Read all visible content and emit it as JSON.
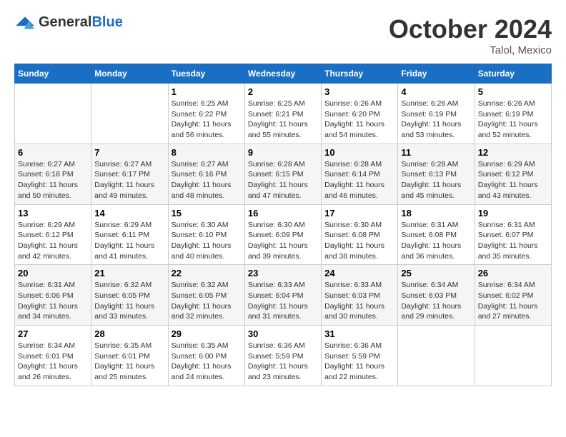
{
  "header": {
    "logo_general": "General",
    "logo_blue": "Blue",
    "month_title": "October 2024",
    "location": "Talol, Mexico"
  },
  "weekdays": [
    "Sunday",
    "Monday",
    "Tuesday",
    "Wednesday",
    "Thursday",
    "Friday",
    "Saturday"
  ],
  "weeks": [
    [
      {
        "day": "",
        "sunrise": "",
        "sunset": "",
        "daylight": ""
      },
      {
        "day": "",
        "sunrise": "",
        "sunset": "",
        "daylight": ""
      },
      {
        "day": "1",
        "sunrise": "Sunrise: 6:25 AM",
        "sunset": "Sunset: 6:22 PM",
        "daylight": "Daylight: 11 hours and 56 minutes."
      },
      {
        "day": "2",
        "sunrise": "Sunrise: 6:25 AM",
        "sunset": "Sunset: 6:21 PM",
        "daylight": "Daylight: 11 hours and 55 minutes."
      },
      {
        "day": "3",
        "sunrise": "Sunrise: 6:26 AM",
        "sunset": "Sunset: 6:20 PM",
        "daylight": "Daylight: 11 hours and 54 minutes."
      },
      {
        "day": "4",
        "sunrise": "Sunrise: 6:26 AM",
        "sunset": "Sunset: 6:19 PM",
        "daylight": "Daylight: 11 hours and 53 minutes."
      },
      {
        "day": "5",
        "sunrise": "Sunrise: 6:26 AM",
        "sunset": "Sunset: 6:19 PM",
        "daylight": "Daylight: 11 hours and 52 minutes."
      }
    ],
    [
      {
        "day": "6",
        "sunrise": "Sunrise: 6:27 AM",
        "sunset": "Sunset: 6:18 PM",
        "daylight": "Daylight: 11 hours and 50 minutes."
      },
      {
        "day": "7",
        "sunrise": "Sunrise: 6:27 AM",
        "sunset": "Sunset: 6:17 PM",
        "daylight": "Daylight: 11 hours and 49 minutes."
      },
      {
        "day": "8",
        "sunrise": "Sunrise: 6:27 AM",
        "sunset": "Sunset: 6:16 PM",
        "daylight": "Daylight: 11 hours and 48 minutes."
      },
      {
        "day": "9",
        "sunrise": "Sunrise: 6:28 AM",
        "sunset": "Sunset: 6:15 PM",
        "daylight": "Daylight: 11 hours and 47 minutes."
      },
      {
        "day": "10",
        "sunrise": "Sunrise: 6:28 AM",
        "sunset": "Sunset: 6:14 PM",
        "daylight": "Daylight: 11 hours and 46 minutes."
      },
      {
        "day": "11",
        "sunrise": "Sunrise: 6:28 AM",
        "sunset": "Sunset: 6:13 PM",
        "daylight": "Daylight: 11 hours and 45 minutes."
      },
      {
        "day": "12",
        "sunrise": "Sunrise: 6:29 AM",
        "sunset": "Sunset: 6:12 PM",
        "daylight": "Daylight: 11 hours and 43 minutes."
      }
    ],
    [
      {
        "day": "13",
        "sunrise": "Sunrise: 6:29 AM",
        "sunset": "Sunset: 6:12 PM",
        "daylight": "Daylight: 11 hours and 42 minutes."
      },
      {
        "day": "14",
        "sunrise": "Sunrise: 6:29 AM",
        "sunset": "Sunset: 6:11 PM",
        "daylight": "Daylight: 11 hours and 41 minutes."
      },
      {
        "day": "15",
        "sunrise": "Sunrise: 6:30 AM",
        "sunset": "Sunset: 6:10 PM",
        "daylight": "Daylight: 11 hours and 40 minutes."
      },
      {
        "day": "16",
        "sunrise": "Sunrise: 6:30 AM",
        "sunset": "Sunset: 6:09 PM",
        "daylight": "Daylight: 11 hours and 39 minutes."
      },
      {
        "day": "17",
        "sunrise": "Sunrise: 6:30 AM",
        "sunset": "Sunset: 6:08 PM",
        "daylight": "Daylight: 11 hours and 38 minutes."
      },
      {
        "day": "18",
        "sunrise": "Sunrise: 6:31 AM",
        "sunset": "Sunset: 6:08 PM",
        "daylight": "Daylight: 11 hours and 36 minutes."
      },
      {
        "day": "19",
        "sunrise": "Sunrise: 6:31 AM",
        "sunset": "Sunset: 6:07 PM",
        "daylight": "Daylight: 11 hours and 35 minutes."
      }
    ],
    [
      {
        "day": "20",
        "sunrise": "Sunrise: 6:31 AM",
        "sunset": "Sunset: 6:06 PM",
        "daylight": "Daylight: 11 hours and 34 minutes."
      },
      {
        "day": "21",
        "sunrise": "Sunrise: 6:32 AM",
        "sunset": "Sunset: 6:05 PM",
        "daylight": "Daylight: 11 hours and 33 minutes."
      },
      {
        "day": "22",
        "sunrise": "Sunrise: 6:32 AM",
        "sunset": "Sunset: 6:05 PM",
        "daylight": "Daylight: 11 hours and 32 minutes."
      },
      {
        "day": "23",
        "sunrise": "Sunrise: 6:33 AM",
        "sunset": "Sunset: 6:04 PM",
        "daylight": "Daylight: 11 hours and 31 minutes."
      },
      {
        "day": "24",
        "sunrise": "Sunrise: 6:33 AM",
        "sunset": "Sunset: 6:03 PM",
        "daylight": "Daylight: 11 hours and 30 minutes."
      },
      {
        "day": "25",
        "sunrise": "Sunrise: 6:34 AM",
        "sunset": "Sunset: 6:03 PM",
        "daylight": "Daylight: 11 hours and 29 minutes."
      },
      {
        "day": "26",
        "sunrise": "Sunrise: 6:34 AM",
        "sunset": "Sunset: 6:02 PM",
        "daylight": "Daylight: 11 hours and 27 minutes."
      }
    ],
    [
      {
        "day": "27",
        "sunrise": "Sunrise: 6:34 AM",
        "sunset": "Sunset: 6:01 PM",
        "daylight": "Daylight: 11 hours and 26 minutes."
      },
      {
        "day": "28",
        "sunrise": "Sunrise: 6:35 AM",
        "sunset": "Sunset: 6:01 PM",
        "daylight": "Daylight: 11 hours and 25 minutes."
      },
      {
        "day": "29",
        "sunrise": "Sunrise: 6:35 AM",
        "sunset": "Sunset: 6:00 PM",
        "daylight": "Daylight: 11 hours and 24 minutes."
      },
      {
        "day": "30",
        "sunrise": "Sunrise: 6:36 AM",
        "sunset": "Sunset: 5:59 PM",
        "daylight": "Daylight: 11 hours and 23 minutes."
      },
      {
        "day": "31",
        "sunrise": "Sunrise: 6:36 AM",
        "sunset": "Sunset: 5:59 PM",
        "daylight": "Daylight: 11 hours and 22 minutes."
      },
      {
        "day": "",
        "sunrise": "",
        "sunset": "",
        "daylight": ""
      },
      {
        "day": "",
        "sunrise": "",
        "sunset": "",
        "daylight": ""
      }
    ]
  ]
}
